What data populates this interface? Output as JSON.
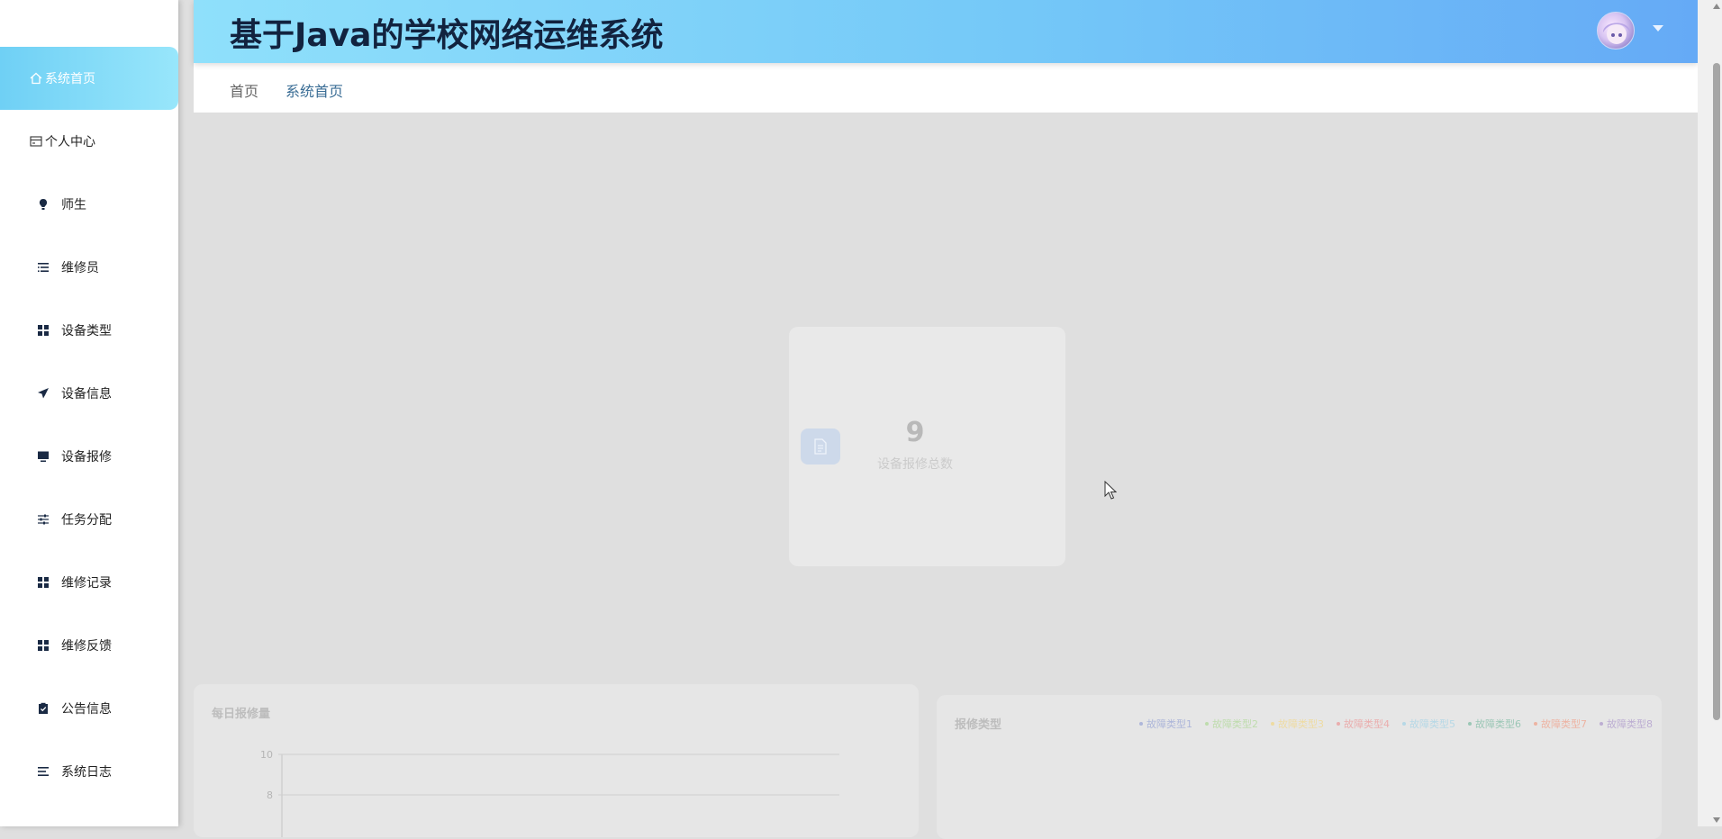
{
  "header": {
    "app_title": "基于Java的学校网络运维系统"
  },
  "breadcrumb": {
    "home": "首页",
    "current": "系统首页"
  },
  "sidebar": {
    "items": [
      {
        "label": "系统首页",
        "icon": "home-icon",
        "active": true
      },
      {
        "label": "个人中心",
        "icon": "card-icon",
        "active": false
      },
      {
        "label": "师生",
        "icon": "bulb-icon",
        "active": false
      },
      {
        "label": "维修员",
        "icon": "list-indent-icon",
        "active": false
      },
      {
        "label": "设备类型",
        "icon": "grid-icon",
        "active": false
      },
      {
        "label": "设备信息",
        "icon": "paper-plane-icon",
        "active": false
      },
      {
        "label": "设备报修",
        "icon": "monitor-icon",
        "active": false
      },
      {
        "label": "任务分配",
        "icon": "sliders-icon",
        "active": false
      },
      {
        "label": "维修记录",
        "icon": "grid-icon",
        "active": false
      },
      {
        "label": "维修反馈",
        "icon": "grid-icon",
        "active": false
      },
      {
        "label": "公告信息",
        "icon": "clipboard-check-icon",
        "active": false
      },
      {
        "label": "系统日志",
        "icon": "menu-lines-icon",
        "active": false
      }
    ]
  },
  "stat_card": {
    "value": "9",
    "label": "设备报修总数",
    "icon": "document-icon"
  },
  "daily_panel": {
    "title": "每日报修量"
  },
  "type_panel": {
    "title": "报修类型",
    "legend": [
      {
        "name": "故障类型1",
        "color": "#7f8fd0"
      },
      {
        "name": "故障类型2",
        "color": "#9fd47f"
      },
      {
        "name": "故障类型3",
        "color": "#f5d36b"
      },
      {
        "name": "故障类型4",
        "color": "#ee7f7f"
      },
      {
        "name": "故障类型5",
        "color": "#8fcde6"
      },
      {
        "name": "故障类型6",
        "color": "#5fae8f"
      },
      {
        "name": "故障类型7",
        "color": "#f48a6b"
      },
      {
        "name": "故障类型8",
        "color": "#9a7fc2"
      }
    ]
  },
  "chart_data": {
    "type": "line",
    "title": "每日报修量",
    "ylim": [
      0,
      10
    ],
    "y_ticks": [
      10,
      8
    ],
    "x": [],
    "series": []
  },
  "colors": {
    "header_gradient_start": "#8fe0fb",
    "header_gradient_end": "#65aaf6",
    "sidebar_active": "#6fd0f5",
    "title_text": "#12233f"
  }
}
